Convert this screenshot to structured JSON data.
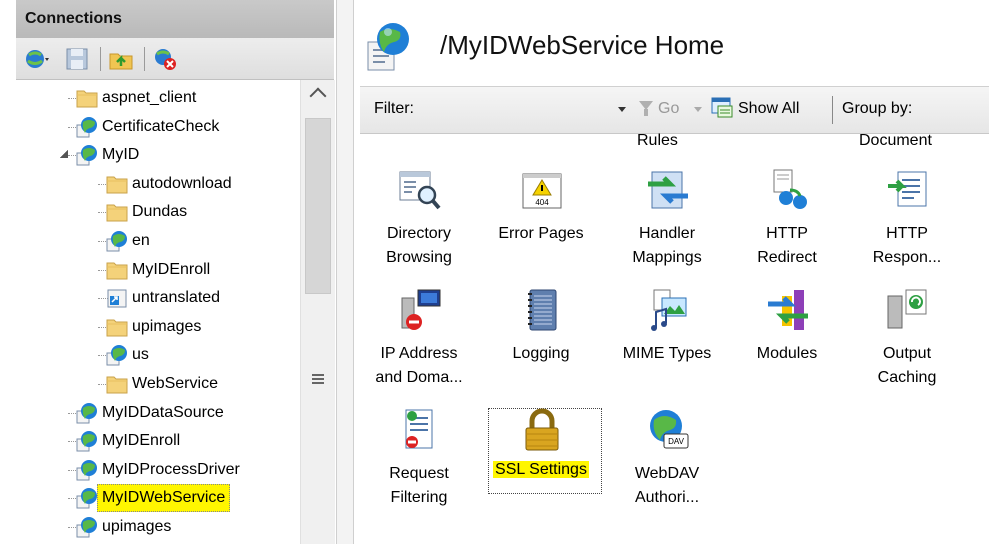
{
  "connections": {
    "header": "Connections",
    "toolbar_icons": [
      "connect-icon",
      "save-icon",
      "up-folder-icon",
      "disconnect-icon"
    ],
    "tree": [
      {
        "label": "aspnet_client",
        "type": "folder",
        "depth": 1
      },
      {
        "label": "CertificateCheck",
        "type": "app",
        "depth": 1
      },
      {
        "label": "MyID",
        "type": "app",
        "depth": 1,
        "expanded": true
      },
      {
        "label": "autodownload",
        "type": "folder",
        "depth": 2
      },
      {
        "label": "Dundas",
        "type": "folder",
        "depth": 2
      },
      {
        "label": "en",
        "type": "app",
        "depth": 2
      },
      {
        "label": "MyIDEnroll",
        "type": "folder",
        "depth": 2
      },
      {
        "label": "untranslated",
        "type": "vdir",
        "depth": 2
      },
      {
        "label": "upimages",
        "type": "folder",
        "depth": 2
      },
      {
        "label": "us",
        "type": "app",
        "depth": 2
      },
      {
        "label": "WebService",
        "type": "folder",
        "depth": 2
      },
      {
        "label": "MyIDDataSource",
        "type": "app",
        "depth": 1
      },
      {
        "label": "MyIDEnroll",
        "type": "app",
        "depth": 1
      },
      {
        "label": "MyIDProcessDriver",
        "type": "app",
        "depth": 1
      },
      {
        "label": "MyIDWebService",
        "type": "app",
        "depth": 1,
        "highlighted": true
      },
      {
        "label": "upimages",
        "type": "app",
        "depth": 1
      }
    ]
  },
  "main": {
    "title": "/MyIDWebService Home",
    "filterbar": {
      "filter_label": "Filter:",
      "filter_value": "",
      "go_label": "Go",
      "show_all_label": "Show All",
      "group_by_label": "Group by:"
    },
    "cut_labels": {
      "rules": "Rules",
      "document": "Document"
    },
    "features": [
      {
        "line1": "Directory",
        "line2": "Browsing",
        "icon": "directory-browsing-icon"
      },
      {
        "line1": "Error Pages",
        "line2": "",
        "icon": "error-pages-icon"
      },
      {
        "line1": "Handler",
        "line2": "Mappings",
        "icon": "handler-mappings-icon"
      },
      {
        "line1": "HTTP",
        "line2": "Redirect",
        "icon": "http-redirect-icon"
      },
      {
        "line1": "HTTP",
        "line2": "Respon...",
        "icon": "http-response-icon"
      },
      {
        "line1": "IP Address",
        "line2": "and Doma...",
        "icon": "ip-address-icon"
      },
      {
        "line1": "Logging",
        "line2": "",
        "icon": "logging-icon"
      },
      {
        "line1": "MIME Types",
        "line2": "",
        "icon": "mime-types-icon"
      },
      {
        "line1": "Modules",
        "line2": "",
        "icon": "modules-icon"
      },
      {
        "line1": "Output",
        "line2": "Caching",
        "icon": "output-caching-icon"
      },
      {
        "line1": "Request",
        "line2": "Filtering",
        "icon": "request-filtering-icon"
      },
      {
        "line1": "SSL Settings",
        "line2": "",
        "icon": "lock-icon",
        "selected": true
      },
      {
        "line1": "WebDAV",
        "line2": "Authori...",
        "icon": "webdav-icon"
      }
    ],
    "colors": {
      "highlight": "#fff600",
      "globe": "#1f7fd6",
      "folder": "#f4d27a"
    }
  }
}
